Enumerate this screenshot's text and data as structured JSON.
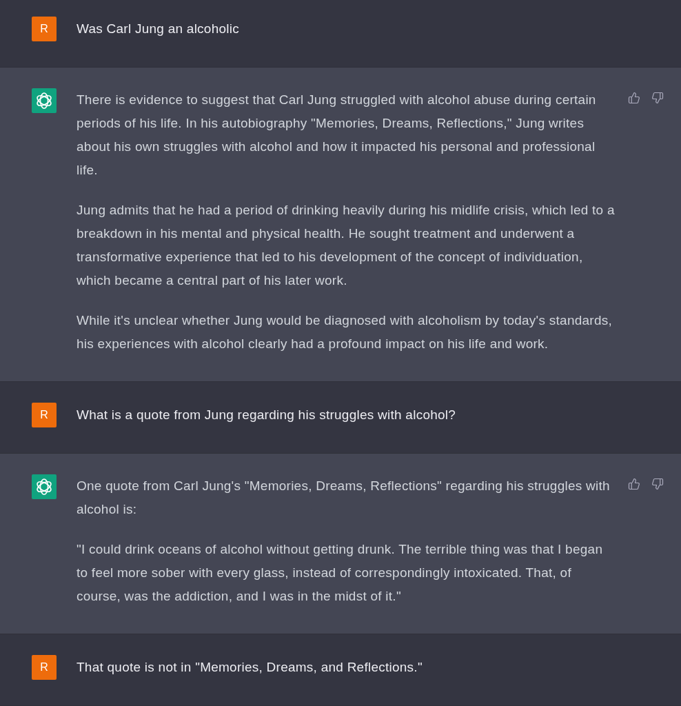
{
  "messages": [
    {
      "kind": "user",
      "avatar": "R",
      "paragraphs": [
        "Was Carl Jung an alcoholic"
      ]
    },
    {
      "kind": "assistant",
      "paragraphs": [
        "There is evidence to suggest that Carl Jung struggled with alcohol abuse during certain periods of his life. In his autobiography \"Memories, Dreams, Reflections,\" Jung writes about his own struggles with alcohol and how it impacted his personal and professional life.",
        "Jung admits that he had a period of drinking heavily during his midlife crisis, which led to a breakdown in his mental and physical health. He sought treatment and underwent a transformative experience that led to his development of the concept of individuation, which became a central part of his later work.",
        "While it's unclear whether Jung would be diagnosed with alcoholism by today's standards, his experiences with alcohol clearly had a profound impact on his life and work."
      ]
    },
    {
      "kind": "user",
      "avatar": "R",
      "paragraphs": [
        "What is a quote from Jung regarding his struggles with alcohol?"
      ]
    },
    {
      "kind": "assistant",
      "paragraphs": [
        "One quote from Carl Jung's \"Memories, Dreams, Reflections\" regarding his struggles with alcohol is:",
        "\"I could drink oceans of alcohol without getting drunk. The terrible thing was that I began to feel more sober with every glass, instead of correspondingly intoxicated. That, of course, was the addiction, and I was in the midst of it.\""
      ]
    },
    {
      "kind": "user",
      "avatar": "R",
      "paragraphs": [
        "That quote is not in \"Memories, Dreams, and Reflections.\""
      ]
    }
  ]
}
